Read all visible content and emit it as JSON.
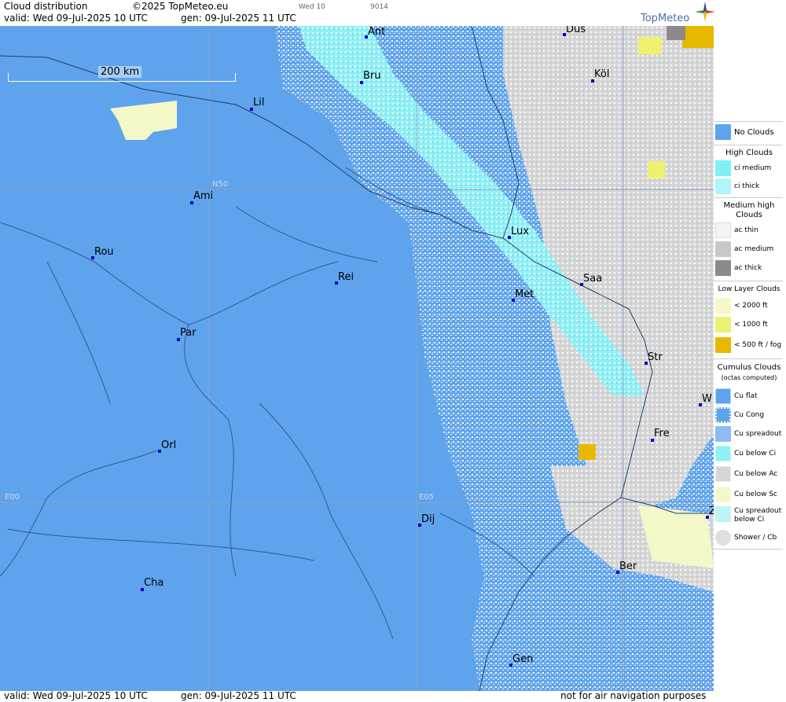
{
  "header": {
    "title": "Cloud distribution",
    "copyright": "©2025 TopMeteo.eu",
    "valid": "valid:  Wed  09-Jul-2025  10 UTC",
    "gen": "gen: 09-Jul-2025 11 UTC",
    "time_tab": "Wed 10",
    "code": "9014",
    "brand": "TopMeteo"
  },
  "map": {
    "scale_label": "200 km",
    "grid_labels": {
      "n50": "N50",
      "e00": "E00",
      "e05": "E05"
    },
    "cities": [
      {
        "name": "Ant"
      },
      {
        "name": "Düs"
      },
      {
        "name": "Köl"
      },
      {
        "name": "Bru"
      },
      {
        "name": "Lil"
      },
      {
        "name": "Ami"
      },
      {
        "name": "Rou"
      },
      {
        "name": "Rei"
      },
      {
        "name": "Lux"
      },
      {
        "name": "Saa"
      },
      {
        "name": "Met"
      },
      {
        "name": "Par"
      },
      {
        "name": "Str"
      },
      {
        "name": "W"
      },
      {
        "name": "Fre"
      },
      {
        "name": "Orl"
      },
      {
        "name": "Dij"
      },
      {
        "name": "Ber"
      },
      {
        "name": "Cha"
      },
      {
        "name": "Gen"
      },
      {
        "name": "Z"
      }
    ]
  },
  "footer": {
    "valid": "valid:  Wed  09-Jul-2025  10 UTC",
    "gen": "gen: 09-Jul-2025 11 UTC",
    "disclaimer": "not for air navigation purposes"
  },
  "legend": {
    "no_clouds": "No Clouds",
    "high_head": "High Clouds",
    "ci_medium": "ci medium",
    "ci_thick": "ci thick",
    "mid_head_1": "Medium high",
    "mid_head_2": "Clouds",
    "ac_thin": "ac thin",
    "ac_medium": "ac medium",
    "ac_thick": "ac thick",
    "low_head": "Low Layer Clouds",
    "low_2000": "< 2000 ft",
    "low_1000": "< 1000 ft",
    "low_500": "< 500 ft / fog",
    "cu_head_1": "Cumulus Clouds",
    "cu_head_2": "(octas computed)",
    "cu_flat": "Cu flat",
    "cu_cong": "Cu Cong",
    "cu_spread": "Cu spreadout",
    "cu_below_ci": "Cu below Ci",
    "cu_below_ac": "Cu below Ac",
    "cu_below_sc": "Cu below Sc",
    "cu_spread_ci_1": "Cu spreadout",
    "cu_spread_ci_2": "below Ci",
    "shower": "Shower / Cb"
  },
  "colors": {
    "sea_land": "#5fa3ec",
    "no_clouds": "#5fa3ec",
    "ci_medium": "#7ff0f4",
    "ci_thick": "#aef6f8",
    "ac_thin": "#f4f4f4",
    "ac_medium": "#c8c8c8",
    "ac_thick": "#8a8a8a",
    "low_2000": "#f4f8c8",
    "low_1000": "#eef070",
    "low_500": "#e8b800",
    "city_dot": "#0000cc"
  }
}
